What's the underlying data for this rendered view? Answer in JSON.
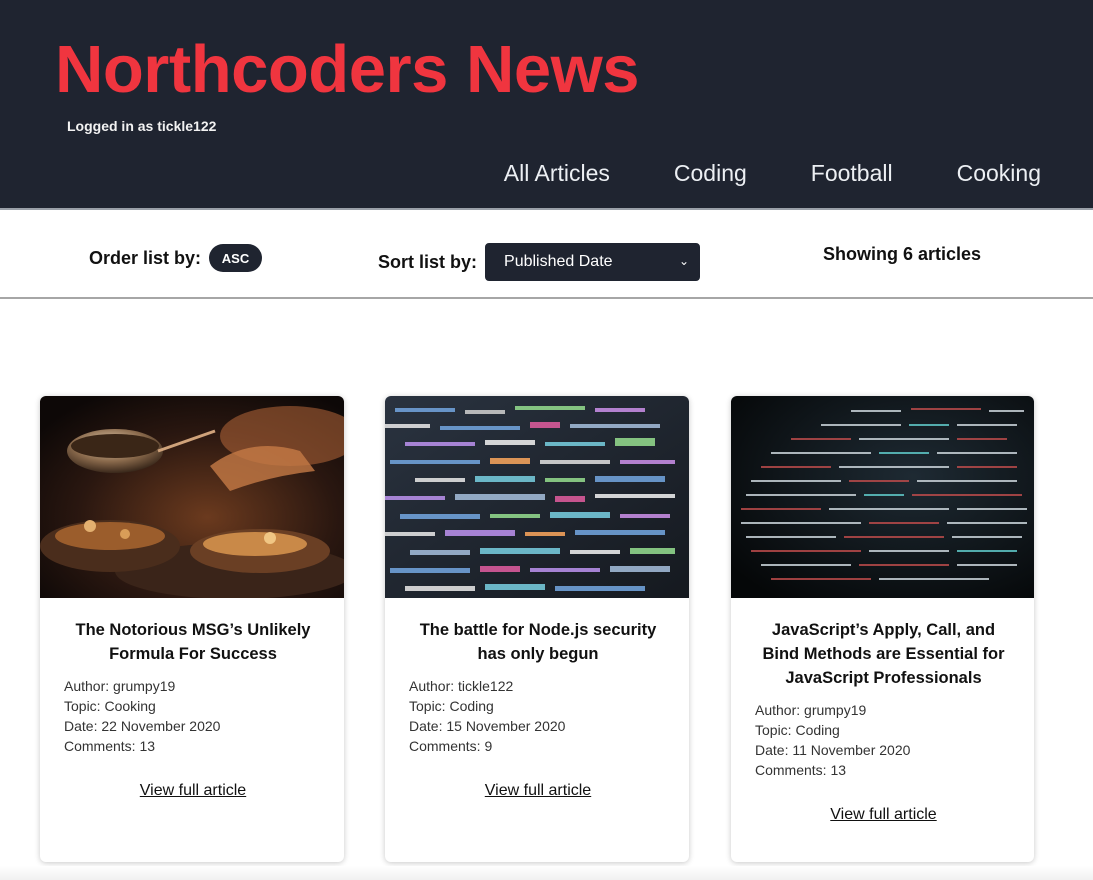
{
  "header": {
    "title": "Northcoders News",
    "login_status": "Logged in as tickle122",
    "nav": [
      "All Articles",
      "Coding",
      "Football",
      "Cooking"
    ]
  },
  "controls": {
    "order_label": "Order list by:",
    "order_value": "ASC",
    "sort_label": "Sort list by:",
    "sort_value": "Published Date",
    "count_text": "Showing 6 articles"
  },
  "articles": [
    {
      "title": "The Notorious MSG’s Unlikely Formula For Success",
      "author": "Author: grumpy19",
      "topic": "Topic: Cooking",
      "date": "Date: 22 November 2020",
      "comments": "Comments: 13",
      "link": "View full article",
      "image": "cooking-photo"
    },
    {
      "title": "The battle for Node.js security has only begun",
      "author": "Author: tickle122",
      "topic": "Topic: Coding",
      "date": "Date: 15 November 2020",
      "comments": "Comments: 9",
      "link": "View full article",
      "image": "code-screen-photo"
    },
    {
      "title": "JavaScript’s Apply, Call, and Bind Methods are Essential for JavaScript Professionals",
      "author": "Author: grumpy19",
      "topic": "Topic: Coding",
      "date": "Date: 11 November 2020",
      "comments": "Comments: 13",
      "link": "View full article",
      "image": "dark-code-photo"
    }
  ],
  "colors": {
    "header_bg": "#1f2430",
    "title_red": "#f0353f"
  }
}
